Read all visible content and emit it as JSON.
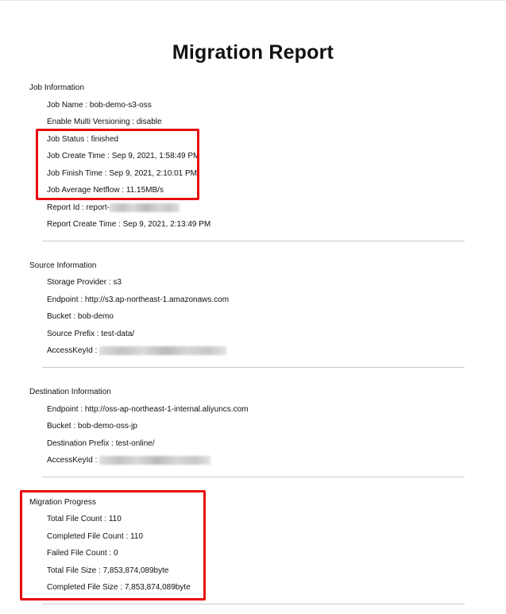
{
  "title": "Migration Report",
  "sections": {
    "job": {
      "title": "Job Information",
      "rows": [
        {
          "key": "Job Name",
          "value": "bob-demo-s3-oss"
        },
        {
          "key": "Enable Multi Versioning",
          "value": "disable"
        },
        {
          "key": "Job Status",
          "value": "finished"
        },
        {
          "key": "Job Create Time",
          "value": "Sep 9, 2021, 1:58:49 PM"
        },
        {
          "key": "Job Finish Time",
          "value": "Sep 9, 2021, 2:10:01 PM"
        },
        {
          "key": "Job Average Netflow",
          "value": "11.15MB/s"
        },
        {
          "key": "Report Id",
          "value": "report-"
        },
        {
          "key": "Report Create Time",
          "value": "Sep 9, 2021, 2:13:49 PM"
        }
      ]
    },
    "source": {
      "title": "Source Information",
      "rows": [
        {
          "key": "Storage Provider",
          "value": "s3"
        },
        {
          "key": "Endpoint",
          "value": "http://s3.ap-northeast-1.amazonaws.com"
        },
        {
          "key": "Bucket",
          "value": "bob-demo"
        },
        {
          "key": "Source Prefix",
          "value": "test-data/"
        },
        {
          "key": "AccessKeyId",
          "value": ""
        }
      ]
    },
    "destination": {
      "title": "Destination Information",
      "rows": [
        {
          "key": "Endpoint",
          "value": "http://oss-ap-northeast-1-internal.aliyuncs.com"
        },
        {
          "key": "Bucket",
          "value": "bob-demo-oss-jp"
        },
        {
          "key": "Destination Prefix",
          "value": "test-online/"
        },
        {
          "key": "AccessKeyId",
          "value": ""
        }
      ]
    },
    "progress": {
      "title": "Migration Progress",
      "rows": [
        {
          "key": "Total File Count",
          "value": "110"
        },
        {
          "key": "Completed File Count",
          "value": "110"
        },
        {
          "key": "Failed File Count",
          "value": "0"
        },
        {
          "key": "Total File Size",
          "value": "7,853,874,089byte"
        },
        {
          "key": "Completed File Size",
          "value": "7,853,874,089byte"
        }
      ]
    }
  },
  "separator": " : ",
  "colors": {
    "highlight": "#e8090d",
    "divider": "#c9c9c9"
  }
}
